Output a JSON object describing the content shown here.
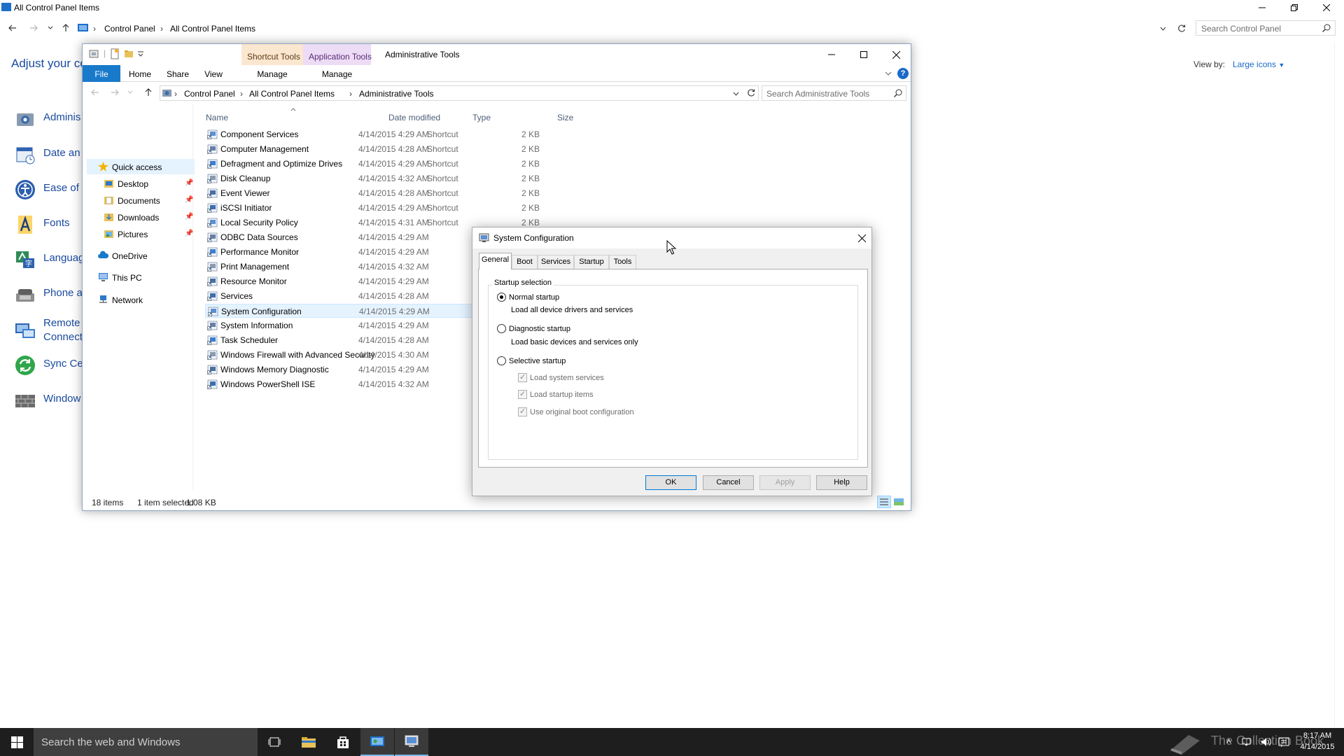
{
  "control_panel": {
    "title": "All Control Panel Items",
    "breadcrumbs": [
      "Control Panel",
      "All Control Panel Items"
    ],
    "search_placeholder": "Search Control Panel",
    "heading": "Adjust your co",
    "view_by_label": "View by:",
    "view_by_value": "Large icons",
    "items": [
      {
        "label": "Adminis"
      },
      {
        "label": "Date an"
      },
      {
        "label": "Ease of"
      },
      {
        "label": "Fonts"
      },
      {
        "label": "Languag"
      },
      {
        "label": "Phone a"
      },
      {
        "label": "Remote\nConnect"
      },
      {
        "label": "Sync Ce"
      },
      {
        "label": "Window"
      }
    ]
  },
  "explorer": {
    "context_tab_1": "Shortcut Tools",
    "context_tab_2": "Application Tools",
    "title": "Administrative Tools",
    "ribbon_tabs": [
      "File",
      "Home",
      "Share",
      "View",
      "Manage",
      "Manage"
    ],
    "breadcrumbs": [
      "Control Panel",
      "All Control Panel Items",
      "Administrative Tools"
    ],
    "search_placeholder": "Search Administrative Tools",
    "nav": [
      {
        "label": "Quick access"
      },
      {
        "label": "Desktop"
      },
      {
        "label": "Documents"
      },
      {
        "label": "Downloads"
      },
      {
        "label": "Pictures"
      },
      {
        "label": "OneDrive"
      },
      {
        "label": "This PC"
      },
      {
        "label": "Network"
      }
    ],
    "columns": [
      "Name",
      "Date modified",
      "Type",
      "Size"
    ],
    "files": [
      {
        "name": "Component Services",
        "date": "4/14/2015 4:29 AM",
        "type": "Shortcut",
        "size": "2 KB"
      },
      {
        "name": "Computer Management",
        "date": "4/14/2015 4:28 AM",
        "type": "Shortcut",
        "size": "2 KB"
      },
      {
        "name": "Defragment and Optimize Drives",
        "date": "4/14/2015 4:29 AM",
        "type": "Shortcut",
        "size": "2 KB"
      },
      {
        "name": "Disk Cleanup",
        "date": "4/14/2015 4:32 AM",
        "type": "Shortcut",
        "size": "2 KB"
      },
      {
        "name": "Event Viewer",
        "date": "4/14/2015 4:28 AM",
        "type": "Shortcut",
        "size": "2 KB"
      },
      {
        "name": "iSCSI Initiator",
        "date": "4/14/2015 4:29 AM",
        "type": "Shortcut",
        "size": "2 KB"
      },
      {
        "name": "Local Security Policy",
        "date": "4/14/2015 4:31 AM",
        "type": "Shortcut",
        "size": "2 KB"
      },
      {
        "name": "ODBC Data Sources",
        "date": "4/14/2015 4:29 AM",
        "type": "",
        "size": ""
      },
      {
        "name": "Performance Monitor",
        "date": "4/14/2015 4:29 AM",
        "type": "",
        "size": ""
      },
      {
        "name": "Print Management",
        "date": "4/14/2015 4:32 AM",
        "type": "",
        "size": ""
      },
      {
        "name": "Resource Monitor",
        "date": "4/14/2015 4:29 AM",
        "type": "",
        "size": ""
      },
      {
        "name": "Services",
        "date": "4/14/2015 4:28 AM",
        "type": "",
        "size": ""
      },
      {
        "name": "System Configuration",
        "date": "4/14/2015 4:29 AM",
        "type": "",
        "size": ""
      },
      {
        "name": "System Information",
        "date": "4/14/2015 4:29 AM",
        "type": "",
        "size": ""
      },
      {
        "name": "Task Scheduler",
        "date": "4/14/2015 4:28 AM",
        "type": "",
        "size": ""
      },
      {
        "name": "Windows Firewall with Advanced Security",
        "date": "4/14/2015 4:30 AM",
        "type": "",
        "size": ""
      },
      {
        "name": "Windows Memory Diagnostic",
        "date": "4/14/2015 4:29 AM",
        "type": "",
        "size": ""
      },
      {
        "name": "Windows PowerShell ISE",
        "date": "4/14/2015 4:32 AM",
        "type": "",
        "size": ""
      }
    ],
    "status_count": "18 items",
    "status_selected": "1 item selected",
    "status_size": "1.08 KB"
  },
  "dialog": {
    "title": "System Configuration",
    "tabs": [
      "General",
      "Boot",
      "Services",
      "Startup",
      "Tools"
    ],
    "group_label": "Startup selection",
    "normal_label": "Normal startup",
    "normal_desc": "Load all device drivers and services",
    "diagnostic_label": "Diagnostic startup",
    "diagnostic_desc": "Load basic devices and services only",
    "selective_label": "Selective startup",
    "check_1": "Load system services",
    "check_2": "Load startup items",
    "check_3": "Use original boot configuration",
    "ok": "OK",
    "cancel": "Cancel",
    "apply": "Apply",
    "help": "Help"
  },
  "taskbar": {
    "search_placeholder": "Search the web and Windows",
    "watermark": "The Collection Book",
    "time": "8:17 AM",
    "date": "4/14/2015"
  },
  "colors": {
    "accent": "#1979ca",
    "link": "#1a4aa0",
    "taskbar": "#1e1e1e"
  }
}
